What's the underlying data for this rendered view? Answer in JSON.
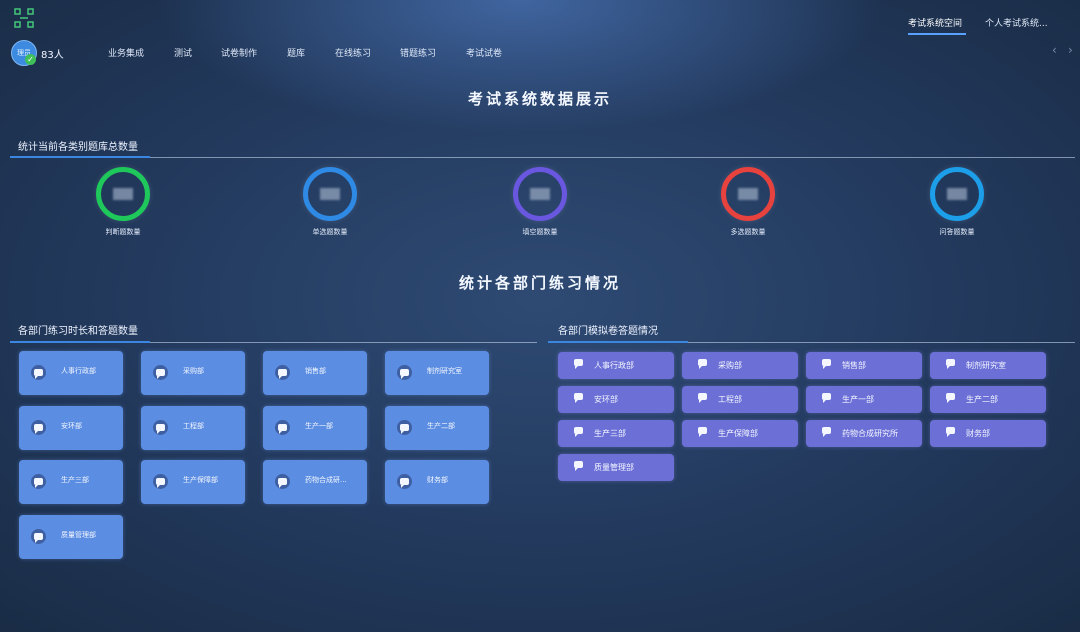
{
  "header": {
    "user_count": "83人",
    "avatar_text": "理员",
    "nav_items": [
      "业务集成",
      "测试",
      "试卷制作",
      "题库",
      "在线练习",
      "错题练习",
      "考试试卷"
    ],
    "top_tabs": [
      "考试系统空间",
      "个人考试系统..."
    ],
    "arrow_left": "‹",
    "arrow_right": "›"
  },
  "page_title": "考试系统数据展示",
  "question_stats": {
    "section_title": "统计当前各类别题库总数量",
    "items": [
      {
        "label": "判断题数量",
        "color": "#1fc85a"
      },
      {
        "label": "单选题数量",
        "color": "#2f8ae6"
      },
      {
        "label": "填空题数量",
        "color": "#6a57e0"
      },
      {
        "label": "多选题数量",
        "color": "#e8423f"
      },
      {
        "label": "问答题数量",
        "color": "#1c9ee8"
      }
    ]
  },
  "dept_title": "统计各部门练习情况",
  "practice_panel": {
    "title": "各部门练习时长和答题数量",
    "departments": [
      "人事行政部",
      "采购部",
      "销售部",
      "制剂研究室",
      "安环部",
      "工程部",
      "生产一部",
      "生产二部",
      "生产三部",
      "生产保障部",
      "药物合成研...",
      "财务部",
      "质量管理部"
    ]
  },
  "mock_panel": {
    "title": "各部门模拟卷答题情况",
    "departments": [
      "人事行政部",
      "采购部",
      "销售部",
      "制剂研究室",
      "安环部",
      "工程部",
      "生产一部",
      "生产二部",
      "生产三部",
      "生产保障部",
      "药物合成研究所",
      "财务部",
      "质量管理部"
    ]
  }
}
